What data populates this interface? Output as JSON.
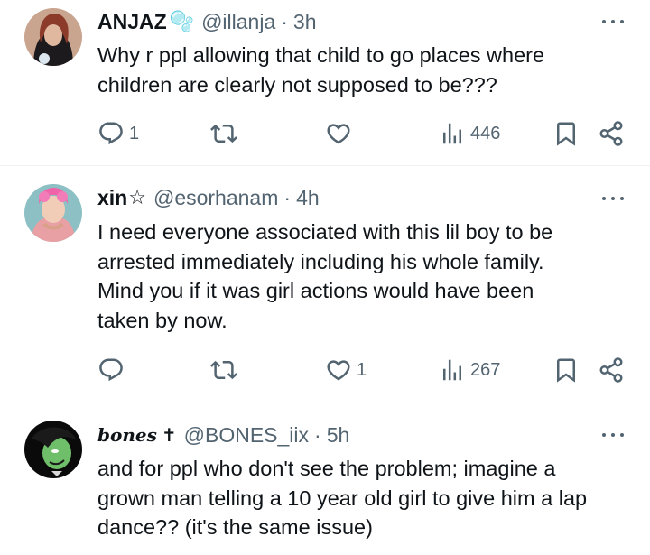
{
  "tweets": [
    {
      "name": "ANJAZ",
      "name_emoji": "🫧",
      "handle": "@illanja",
      "time": "3h",
      "text_lines": [
        "Why r ppl allowing that child to go places where",
        "children are clearly not supposed to be???"
      ],
      "reply_count": "1",
      "retweet_count": "",
      "like_count": "",
      "views": "446"
    },
    {
      "name": "xin",
      "name_emoji": "☆",
      "handle": "@esorhanam",
      "time": "4h",
      "text_lines": [
        "I need everyone associated with this lil boy to be",
        "arrested immediately including his whole family.",
        "Mind you if it was girl actions would have been",
        "taken by now."
      ],
      "reply_count": "",
      "retweet_count": "",
      "like_count": "1",
      "views": "267"
    },
    {
      "name": "bones",
      "name_emoji": "✝",
      "handle": "@BONES_iix",
      "time": "5h",
      "text_lines": [
        "and for ppl who don't see the problem; imagine a",
        "grown man telling a 10 year old girl to give him a lap",
        "dance?? (it's the same issue)"
      ]
    }
  ],
  "separator": "·",
  "icons": {
    "reply": "reply-icon",
    "retweet": "retweet-icon",
    "like": "heart-icon",
    "views": "views-icon",
    "bookmark": "bookmark-icon",
    "share": "share-icon",
    "more": "more-icon"
  },
  "colors": {
    "text": "#0f1419",
    "secondary": "#536471",
    "divider": "#eff3f4"
  }
}
